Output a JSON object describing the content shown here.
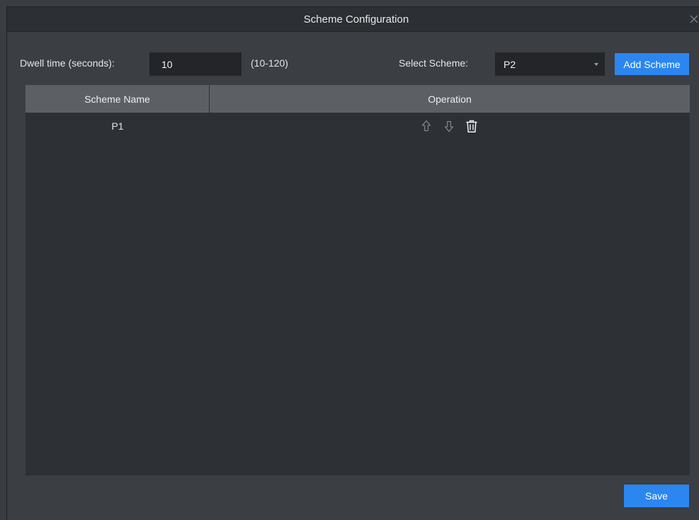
{
  "dialog": {
    "title": "Scheme Configuration",
    "close_icon": "close-icon"
  },
  "toolbar": {
    "dwell_label": "Dwell time (seconds):",
    "dwell_value": "10",
    "range_hint": "(10-120)",
    "scheme_label": "Select Scheme:",
    "scheme_selected": "P2",
    "add_label": "Add Scheme"
  },
  "table": {
    "columns": [
      "Scheme Name",
      "Operation"
    ],
    "rows": [
      {
        "name": "P1",
        "operations": [
          "move-up-icon",
          "move-down-icon",
          "delete-icon"
        ]
      }
    ]
  },
  "footer": {
    "save_label": "Save"
  },
  "colors": {
    "accent": "#2b86f0",
    "dialog_bg": "#3b3e43",
    "table_bg": "#2d3034",
    "header_bg": "#5c5f64"
  }
}
